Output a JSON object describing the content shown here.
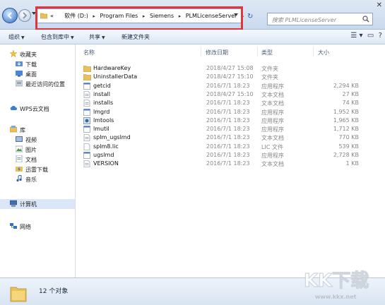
{
  "address_bar": {
    "crumbs": [
      "软件 (D:)",
      "Program Files",
      "Siemens",
      "PLMLicenseServer"
    ],
    "prefix": "«",
    "search_placeholder": "搜索 PLMLicenseServer",
    "refresh_glyph": "↻"
  },
  "toolbar": {
    "items": [
      "组织",
      "包含到库中",
      "共享",
      "新建文件夹"
    ]
  },
  "nav": {
    "favorites_label": "收藏夹",
    "favorites": [
      "下载",
      "桌面",
      "最近访问的位置"
    ],
    "wps": "WPS云文档",
    "library_label": "库",
    "libraries": [
      "视频",
      "图片",
      "文档",
      "迅雷下载",
      "音乐"
    ],
    "computer": "计算机",
    "network": "网络"
  },
  "columns": {
    "name": "名称",
    "date": "修改日期",
    "type": "类型",
    "size": "大小"
  },
  "files": [
    {
      "name": "HardwareKey",
      "date": "2018/4/27 15:08",
      "type": "文件夹",
      "size": "",
      "icon": "folder-icon"
    },
    {
      "name": "UninstallerData",
      "date": "2018/4/27 15:10",
      "type": "文件夹",
      "size": "",
      "icon": "folder-icon"
    },
    {
      "name": "getcid",
      "date": "2016/7/1 18:23",
      "type": "应用程序",
      "size": "2,294 KB",
      "icon": "exe-icon"
    },
    {
      "name": "install",
      "date": "2018/4/27 15:10",
      "type": "文本文档",
      "size": "27 KB",
      "icon": "text-file-icon"
    },
    {
      "name": "installs",
      "date": "2016/7/1 18:23",
      "type": "文本文档",
      "size": "74 KB",
      "icon": "text-file-icon"
    },
    {
      "name": "lmgrd",
      "date": "2016/7/1 18:23",
      "type": "应用程序",
      "size": "1,952 KB",
      "icon": "exe-icon"
    },
    {
      "name": "lmtools",
      "date": "2016/7/1 18:23",
      "type": "应用程序",
      "size": "1,965 KB",
      "icon": "lmtools-icon"
    },
    {
      "name": "lmutil",
      "date": "2016/7/1 18:23",
      "type": "应用程序",
      "size": "1,712 KB",
      "icon": "exe-icon"
    },
    {
      "name": "splm_ugslmd",
      "date": "2016/7/1 18:23",
      "type": "文本文档",
      "size": "770 KB",
      "icon": "text-file-icon"
    },
    {
      "name": "splm8.lic",
      "date": "2016/7/1 18:23",
      "type": "LIC 文件",
      "size": "539 KB",
      "icon": "lic-file-icon"
    },
    {
      "name": "ugslmd",
      "date": "2016/7/1 18:23",
      "type": "应用程序",
      "size": "2,728 KB",
      "icon": "exe-icon"
    },
    {
      "name": "VERSION",
      "date": "2016/7/1 18:23",
      "type": "文本文档",
      "size": "1 KB",
      "icon": "text-file-icon"
    }
  ],
  "status": {
    "count_text": "12 个对象"
  },
  "watermark": {
    "brand": "KK下载",
    "url": "www.kkx.net"
  },
  "colors": {
    "highlight": "#e3343b",
    "folder": "#e8c15a"
  }
}
